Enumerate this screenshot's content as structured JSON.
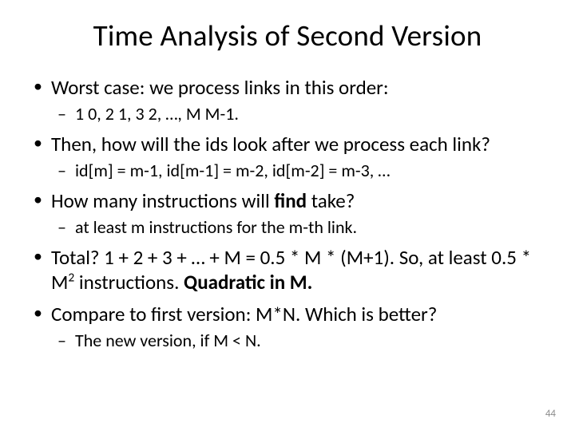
{
  "title": "Time Analysis of Second Version",
  "bullets": {
    "b1": "Worst case: we process links in this order:",
    "b1a": "1 0, 2 1, 3 2, …, M M-1.",
    "b2": "Then, how will the ids look after we process each link?",
    "b2a": "id[m] = m-1, id[m-1] = m-2, id[m-2] = m-3, …",
    "b3_pre": "How many instructions will ",
    "b3_bold": "find",
    "b3_post": " take?",
    "b3a": "at least m instructions for the m-th link.",
    "b4_pre": "Total? 1 + 2 + 3 + … + M = 0.5 * M * (M+1). So, at least 0.5 * M",
    "b4_sup": "2",
    "b4_mid": " instructions.   ",
    "b4_bold": "Quadratic in M.",
    "b5": "Compare to first version: M*N. Which is better?",
    "b5a": "The new version, if M < N."
  },
  "page_number": "44"
}
